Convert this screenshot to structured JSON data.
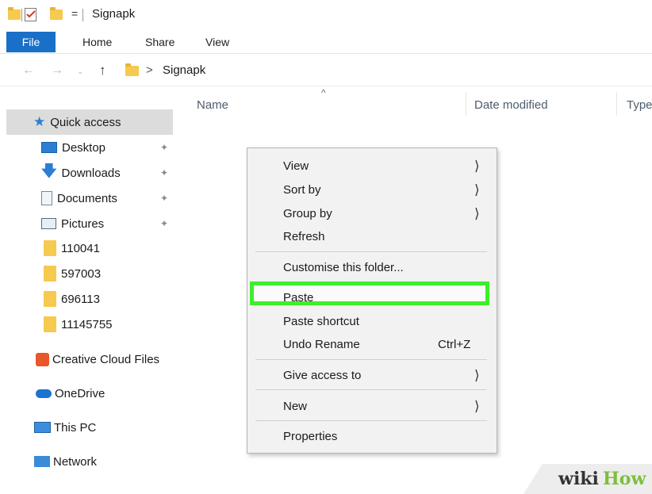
{
  "window": {
    "title": "Signapk",
    "qa_dropdown": "="
  },
  "ribbon": {
    "tabs": [
      "File",
      "Home",
      "Share",
      "View"
    ]
  },
  "address": {
    "path": "Signapk",
    "separator": ">"
  },
  "columns": {
    "name": "Name",
    "date_modified": "Date modified",
    "type": "Type"
  },
  "sidebar": {
    "quick_access": "Quick access",
    "pinned": [
      "Desktop",
      "Downloads",
      "Documents",
      "Pictures"
    ],
    "folders": [
      "110041",
      "597003",
      "696113",
      "11145755"
    ],
    "creative_cloud": "Creative Cloud Files",
    "onedrive": "OneDrive",
    "this_pc": "This PC",
    "network": "Network"
  },
  "context_menu": {
    "view": "View",
    "sort_by": "Sort by",
    "group_by": "Group by",
    "refresh": "Refresh",
    "customise": "Customise this folder...",
    "paste": "Paste",
    "paste_shortcut": "Paste shortcut",
    "undo_rename": "Undo Rename",
    "undo_shortcut": "Ctrl+Z",
    "give_access": "Give access to",
    "new": "New",
    "properties": "Properties"
  },
  "watermark": {
    "wiki": "wiki",
    "how": "How"
  },
  "colors": {
    "accent": "#1a6fc9",
    "highlight": "#3cef2a",
    "selection": "#dcdcdc"
  }
}
